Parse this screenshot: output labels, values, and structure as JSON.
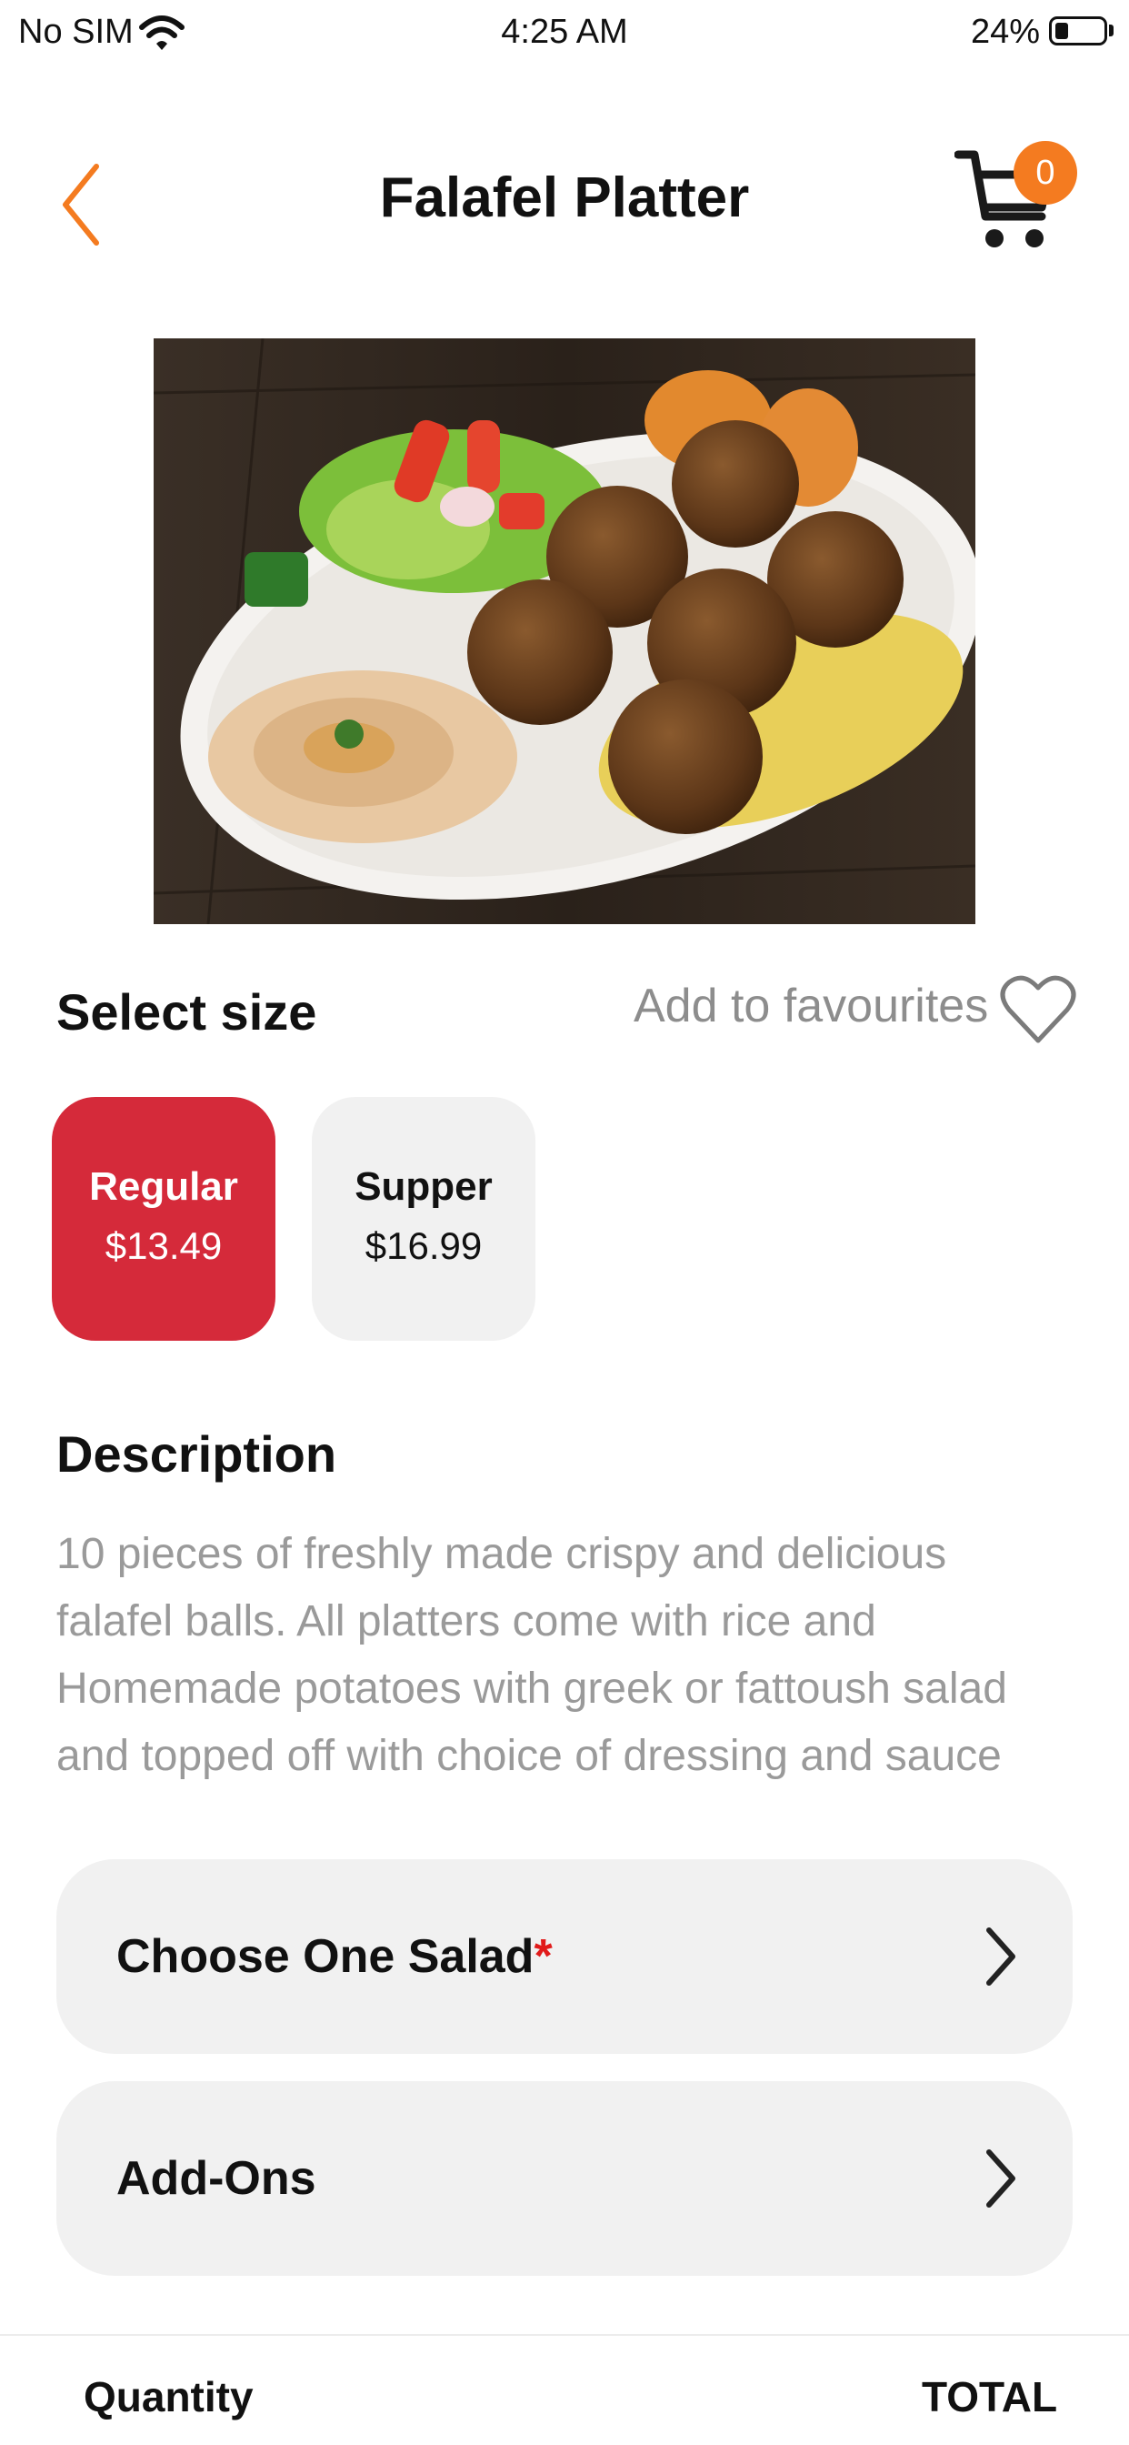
{
  "status_bar": {
    "carrier": "No SIM",
    "time": "4:25 AM",
    "battery": "24%",
    "battery_level": 0.24
  },
  "header": {
    "title": "Falafel Platter",
    "cart_count": "0",
    "back_icon": "chevron-left-icon",
    "cart_icon": "cart-icon"
  },
  "colors": {
    "accent": "#f47b20",
    "selected_size": "#d52a3a",
    "required_marker": "#e11b1b",
    "muted_text": "#9a9a9a",
    "row_background": "#f1f1f1"
  },
  "size": {
    "heading": "Select size",
    "favourites_label": "Add to favourites",
    "favourites_icon": "heart-icon",
    "options": [
      {
        "name": "Regular",
        "price": "$13.49",
        "selected": true
      },
      {
        "name": "Supper",
        "price": "$16.99",
        "selected": false
      }
    ]
  },
  "description": {
    "heading": "Description",
    "lines": [
      "10 pieces of freshly made crispy and delicious",
      "falafel balls. All platters come with rice and",
      "Homemade potatoes with greek or fattoush salad",
      "and topped off with choice of dressing and sauce"
    ]
  },
  "options": {
    "salad": {
      "label": "Choose One Salad",
      "required_marker": "*"
    },
    "addons": {
      "label": "Add-Ons"
    }
  },
  "footer": {
    "quantity_label": "Quantity",
    "total_label": "TOTAL"
  }
}
